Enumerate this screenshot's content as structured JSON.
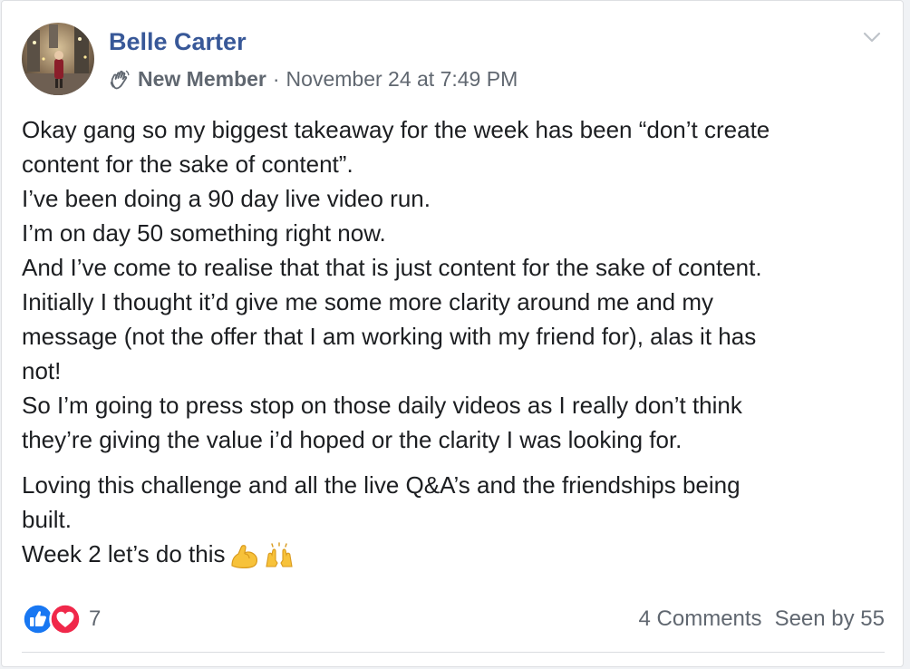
{
  "post": {
    "author_name": "Belle Carter",
    "badge_label": "New Member",
    "separator": "·",
    "timestamp": "November 24 at 7:49 PM",
    "paragraphs": [
      [
        "Okay gang so my biggest takeaway for the week has been “don’t create",
        "content for the sake of content”.",
        "I’ve been doing a 90 day live video run.",
        "I’m on day 50 something right now.",
        "And I’ve come to realise that that is just content for the sake of content.",
        "Initially I thought it’d give me some more clarity around me and my",
        "message (not the offer that I am working with my friend for), alas it has",
        "not!",
        "So I’m going to press stop on those daily videos as I really don’t think",
        "they’re giving the value i’d hoped or the clarity I was looking for."
      ],
      [
        "Loving this challenge and all the live Q&A’s and the friendships being",
        "built.",
        "Week 2 let’s do this"
      ]
    ],
    "emojis": [
      "flexed-biceps-emoji",
      "raising-hands-emoji"
    ]
  },
  "footer": {
    "reaction_icons": [
      "like-icon",
      "love-icon"
    ],
    "reaction_count": "7",
    "comments_label": "4 Comments",
    "seen_label": "Seen by 55"
  },
  "colors": {
    "author": "#385898",
    "meta": "#606770",
    "body_text": "#1c1e21",
    "like_blue": "#1877f2",
    "love_red": "#f0284a"
  }
}
